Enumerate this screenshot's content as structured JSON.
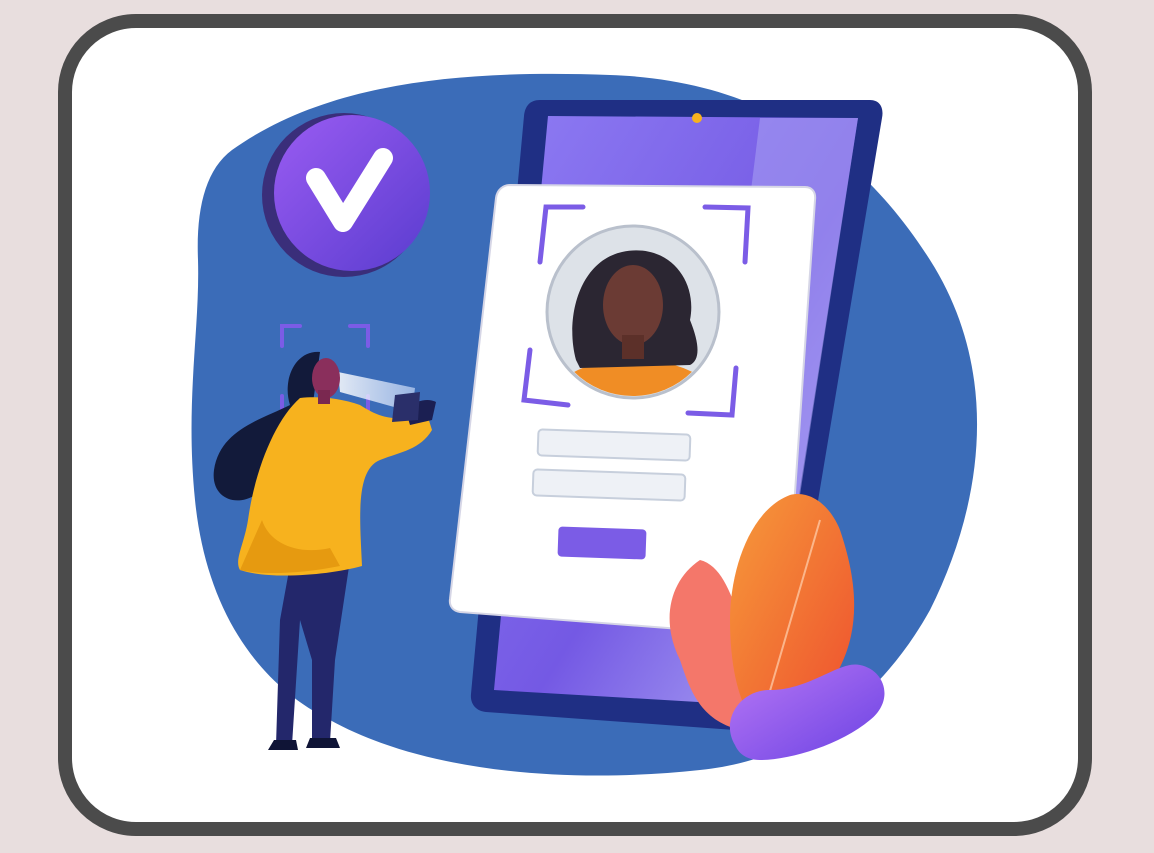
{
  "illustration": {
    "subject": "identity-verification",
    "icons": [
      "verified-check-icon",
      "face-scan-frame-icon",
      "profile-avatar-icon"
    ],
    "colors": {
      "page_background": "#e8dede",
      "frame_border": "#4b4b4b",
      "card_background": "#ffffff",
      "blob_blue": "#3b6cb8",
      "phone_purple": "#7b5ce6",
      "phone_dark": "#1f2f84",
      "badge_purple": "#7a4fe0",
      "jacket_yellow": "#f7b21e",
      "leaf_orange": "#f06a3a",
      "leaf_purple": "#8b5cf0"
    }
  }
}
